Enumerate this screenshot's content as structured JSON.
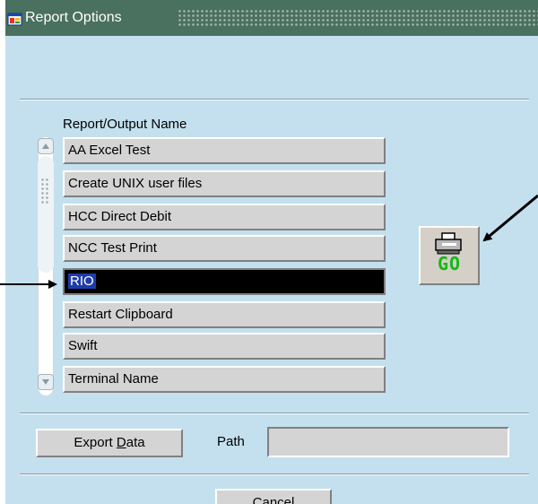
{
  "window": {
    "title": "Report Options"
  },
  "list": {
    "label": "Report/Output Name",
    "items": [
      "AA Excel Test",
      "Create UNIX user files",
      "HCC Direct Debit",
      "NCC Test Print",
      "RIO",
      "Restart Clipboard",
      "Swift",
      "Terminal Name"
    ],
    "selected": "RIO"
  },
  "go_button": {
    "label": "GO",
    "icon": "printer-icon",
    "label_color": "#16b816"
  },
  "export": {
    "label_pre": "Export ",
    "label_access": "D",
    "label_post": "ata"
  },
  "path": {
    "label": "Path",
    "value": ""
  },
  "cancel": {
    "label": "Cancel"
  },
  "colors": {
    "window_bg": "#c4e0ee",
    "titlebar": "#4a7060",
    "selected_bg": "#000000",
    "selected_text_bg": "#1e3ca8"
  }
}
